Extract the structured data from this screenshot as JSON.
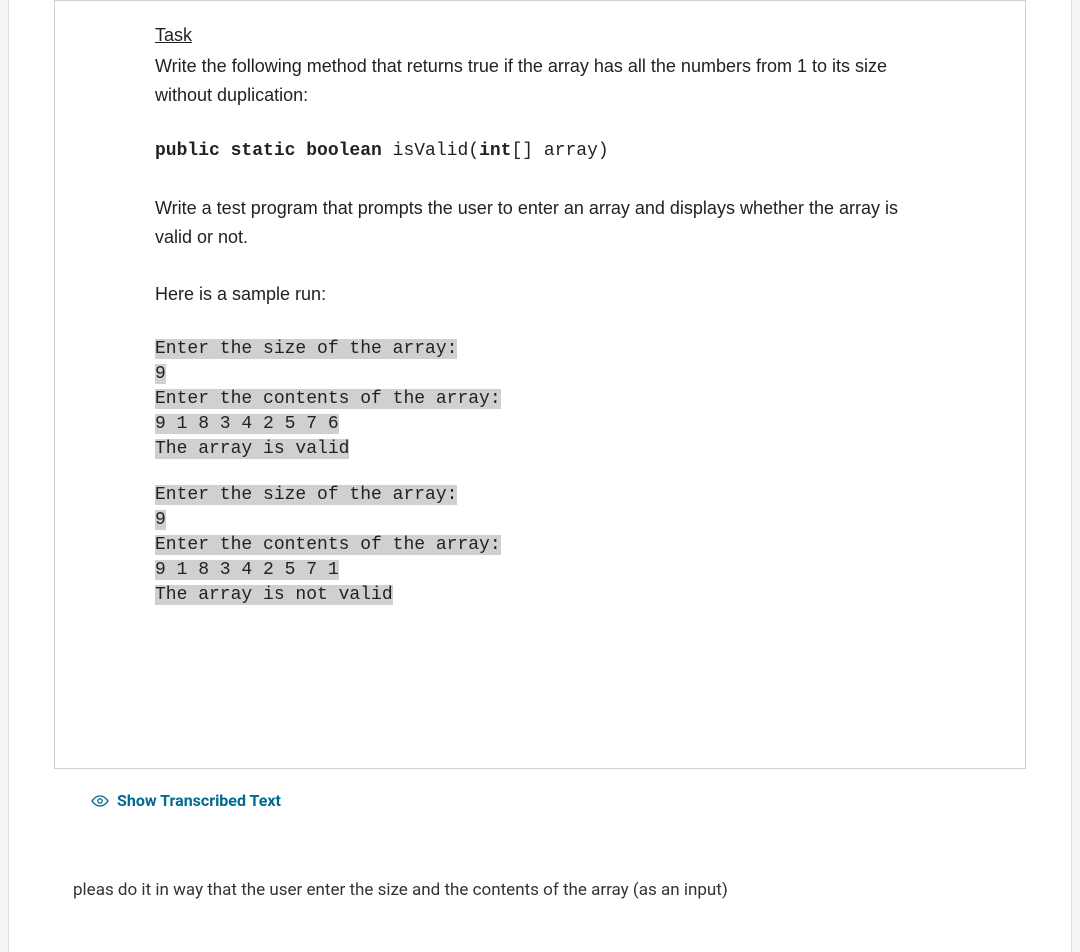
{
  "task": {
    "heading": "Task",
    "description1": "Write the following method that returns true if the array has all the numbers from 1 to its size without duplication:",
    "signature": {
      "keywords": "public static boolean",
      "method": " isValid(",
      "param_type": "int",
      "param_rest": "[] array)"
    },
    "description2": "Write a test program that prompts the user to enter an array and displays whether the array is valid or not.",
    "sample_label": "Here is a sample run:",
    "sample_run_1": [
      "Enter the size of the array:",
      "9",
      "Enter the contents of the array:",
      "9 1 8 3 4 2 5 7 6",
      "The array is valid"
    ],
    "sample_run_2": [
      "Enter the size of the array:",
      "9",
      "Enter the contents of the array:",
      "9 1 8 3 4 2 5 7 1",
      "The array is not valid"
    ]
  },
  "transcribed": {
    "label": "Show Transcribed Text"
  },
  "user_note": "pleas do it in way that the user enter the size and the contents of the array (as an input)"
}
